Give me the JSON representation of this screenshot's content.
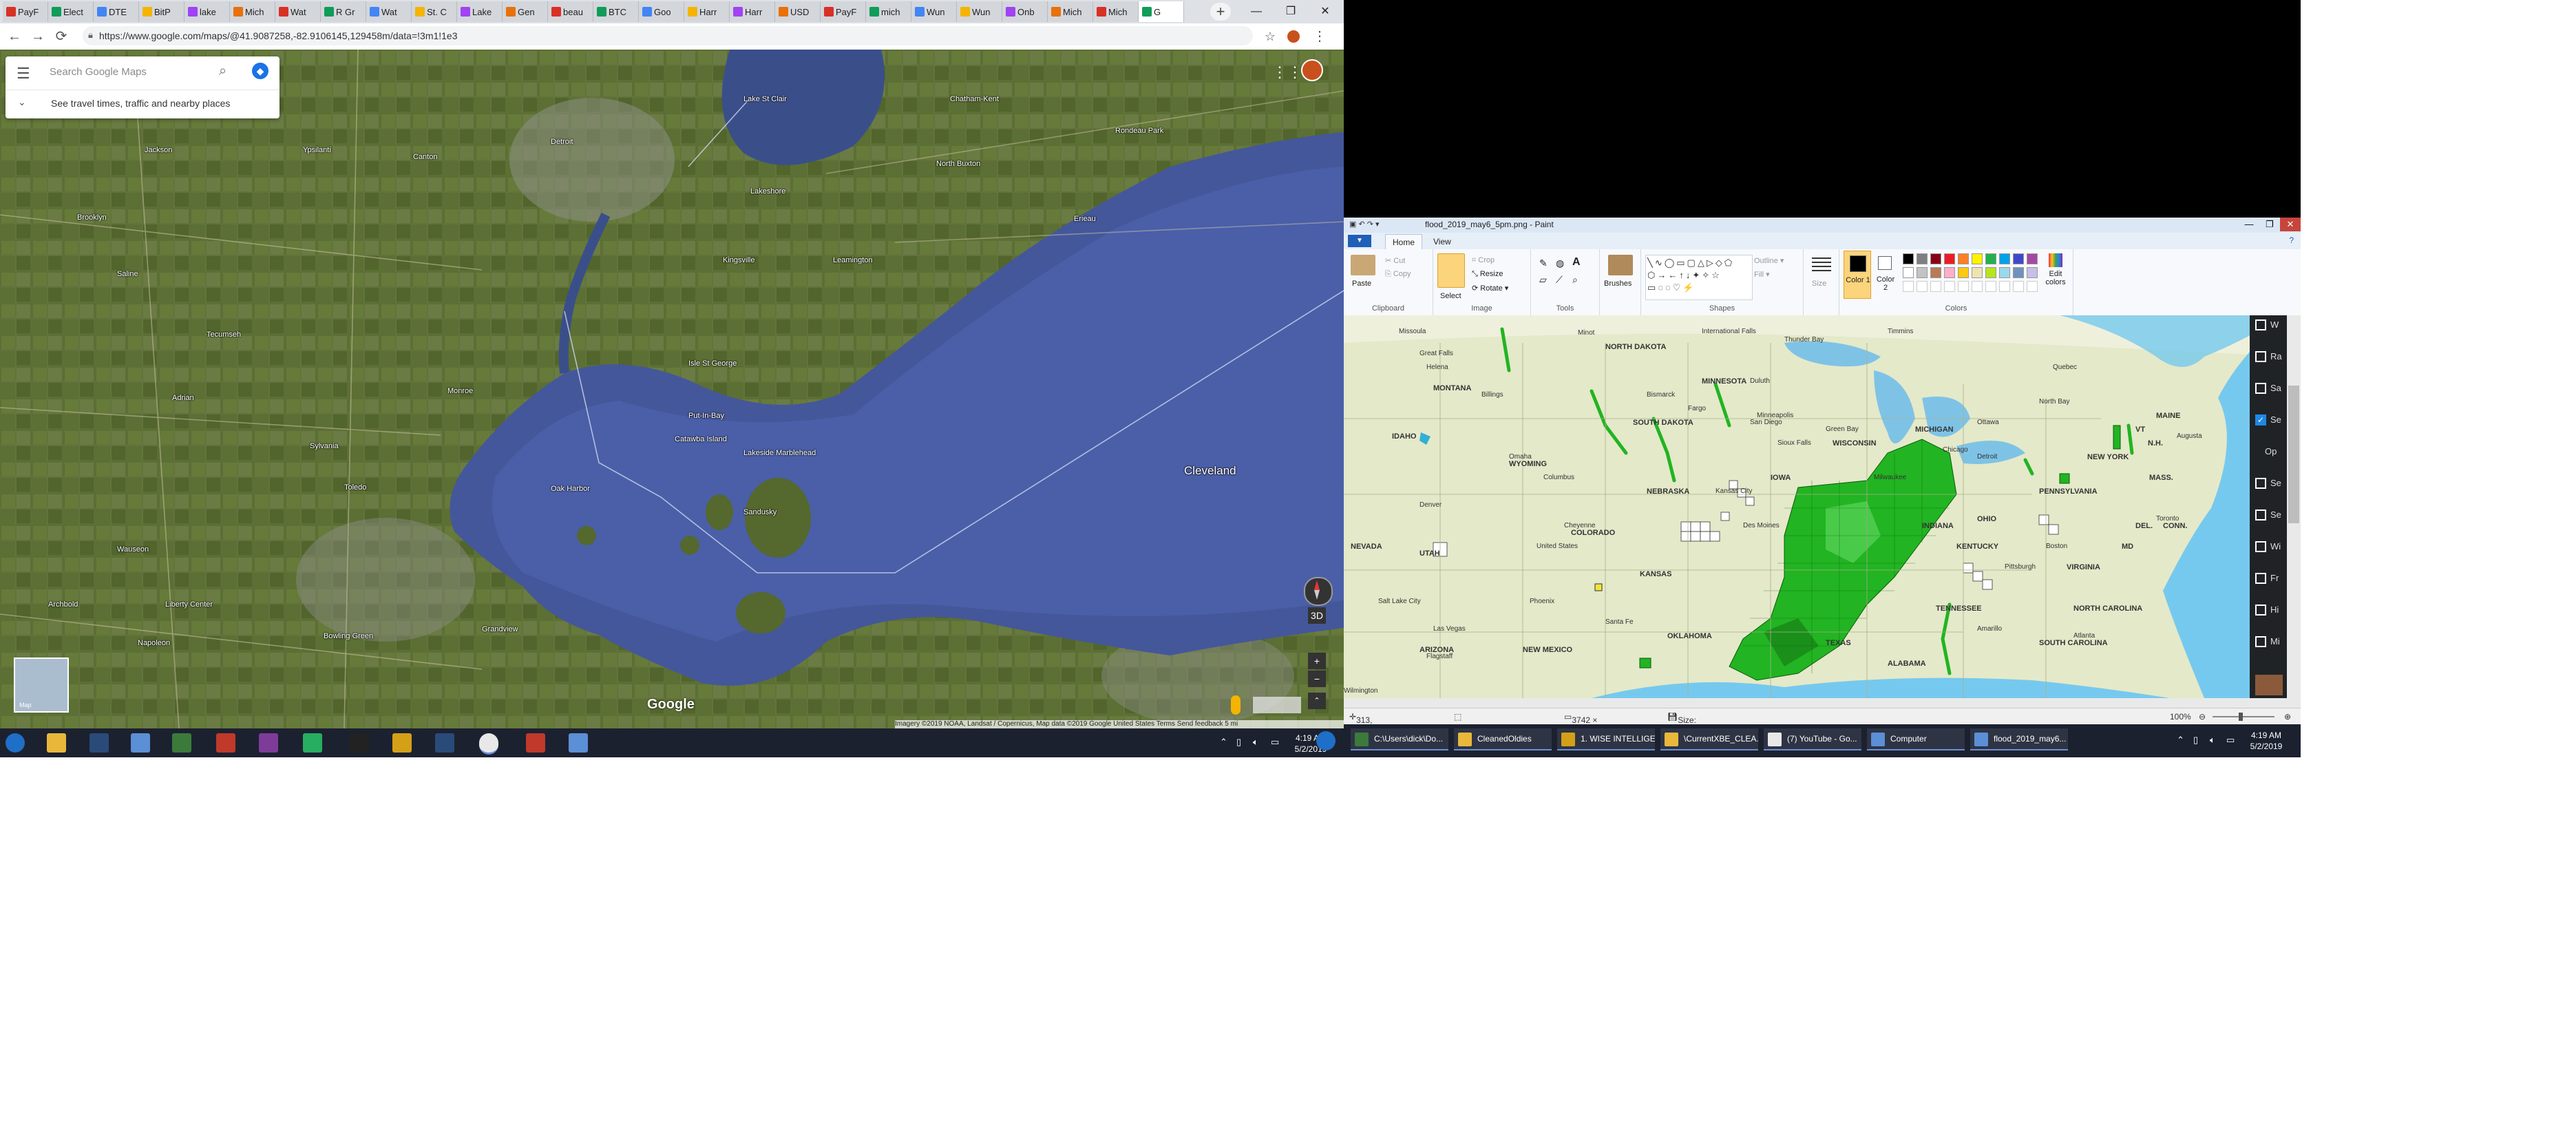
{
  "browser": {
    "tabs": [
      "PayF",
      "Elect",
      "DTE",
      "BitP",
      "lake",
      "Mich",
      "Wat",
      "R Gr",
      "Wat",
      "St. C",
      "Lake",
      "Gen",
      "beau",
      "BTC",
      "Goo",
      "Harr",
      "Harr",
      "USD",
      "PayF",
      "mich",
      "Wun",
      "Wun",
      "Onb",
      "Mich",
      "Mich",
      "G"
    ],
    "new_tab": "+",
    "window_controls": {
      "minimize": "—",
      "maximize": "❐",
      "close": "✕"
    },
    "nav": {
      "back": "←",
      "forward": "→",
      "reload": "⟳"
    },
    "url": "https://www.google.com/maps/@41.9087258,-82.9106145,129458m/data=!3m1!1e3"
  },
  "maps": {
    "search_placeholder": "Search Google Maps",
    "hint": "See travel times, traffic and nearby places",
    "minimap_label": "Map",
    "controls": {
      "tilt": "3D",
      "zoom_in": "+",
      "zoom_out": "−"
    },
    "logo": "Google",
    "attribution": "Imagery ©2019 NOAA, Landsat / Copernicus, Map data ©2019 Google    United States    Terms    Send feedback    5 mi",
    "places": [
      {
        "name": "Detroit",
        "big": false
      },
      {
        "name": "Lake St Clair",
        "big": false
      },
      {
        "name": "Chatham-Kent",
        "big": false
      },
      {
        "name": "Rondeau Park",
        "big": false
      },
      {
        "name": "Lakeshore",
        "big": false
      },
      {
        "name": "North Buxton",
        "big": false
      },
      {
        "name": "Kingsville",
        "big": false
      },
      {
        "name": "Leamington",
        "big": false
      },
      {
        "name": "Erieau",
        "big": false
      },
      {
        "name": "Isle St George",
        "big": false
      },
      {
        "name": "Put-In-Bay",
        "big": false
      },
      {
        "name": "Catawba Island",
        "big": false
      },
      {
        "name": "Lakeside Marblehead",
        "big": false
      },
      {
        "name": "Oak Harbor",
        "big": false
      },
      {
        "name": "Sandusky",
        "big": false
      },
      {
        "name": "Cleveland",
        "big": true
      },
      {
        "name": "Brooklyn",
        "big": false
      },
      {
        "name": "Saline",
        "big": false
      },
      {
        "name": "Tecumseh",
        "big": false
      },
      {
        "name": "Adrian",
        "big": false
      },
      {
        "name": "Monroe",
        "big": false
      },
      {
        "name": "Sylvania",
        "big": false
      },
      {
        "name": "Toledo",
        "big": false
      },
      {
        "name": "Wauseon",
        "big": false
      },
      {
        "name": "Archbold",
        "big": false
      },
      {
        "name": "Liberty Center",
        "big": false
      },
      {
        "name": "Napoleon",
        "big": false
      },
      {
        "name": "Bowling Green",
        "big": false
      },
      {
        "name": "Grandview",
        "big": false
      },
      {
        "name": "Ypsilanti",
        "big": false
      },
      {
        "name": "Canton",
        "big": false
      },
      {
        "name": "Jackson",
        "big": false
      }
    ]
  },
  "paint": {
    "title": "flood_2019_may6_5pm.png - Paint",
    "file_button": "▼",
    "tabs": [
      "Home",
      "View"
    ],
    "clipboard": {
      "paste": "Paste",
      "cut": "Cut",
      "copy": "Copy",
      "group": "Clipboard"
    },
    "image": {
      "select": "Select",
      "crop": "Crop",
      "resize": "Resize",
      "rotate": "Rotate ▾",
      "group": "Image"
    },
    "tools_group": "Tools",
    "brushes": "Brushes",
    "shapes": {
      "outline": "Outline ▾",
      "fill": "Fill ▾",
      "group": "Shapes"
    },
    "size": "Size",
    "color1": "Color 1",
    "color2": "Color 2",
    "edit_colors": "Edit colors",
    "colors_group": "Colors",
    "palette": [
      "#000000",
      "#7f7f7f",
      "#880015",
      "#ed1c24",
      "#ff7f27",
      "#fff200",
      "#22b14c",
      "#00a2e8",
      "#3f48cc",
      "#a349a4",
      "#ffffff",
      "#c3c3c3",
      "#b97a57",
      "#ffaec9",
      "#ffc90e",
      "#efe4b0",
      "#b5e61d",
      "#99d9ea",
      "#7092be",
      "#c8bfe7"
    ],
    "status": {
      "cursor": "313, 487px",
      "dimensions": "3742 × 1634px",
      "size": "Size: 1.3MB",
      "zoom": "100%"
    },
    "map_labels": [
      "NORTH DAKOTA",
      "MINNESOTA",
      "MONTANA",
      "SOUTH DAKOTA",
      "WYOMING",
      "IDAHO",
      "NEBRASKA",
      "IOWA",
      "WISCONSIN",
      "MICHIGAN",
      "COLORADO",
      "KANSAS",
      "UTAH",
      "NEVADA",
      "ARIZONA",
      "NEW MEXICO",
      "OKLAHOMA",
      "TEXAS",
      "INDIANA",
      "OHIO",
      "KENTUCKY",
      "TENNESSEE",
      "ALABAMA",
      "PENNSYLVANIA",
      "VIRGINIA",
      "NORTH CAROLINA",
      "SOUTH CAROLINA",
      "NEW YORK",
      "MAINE",
      "MASS.",
      "VT",
      "N.H.",
      "CONN.",
      "DEL.",
      "MD"
    ],
    "map_cities": [
      "Great Falls",
      "Helena",
      "Billings",
      "Missoula",
      "Minot",
      "Bismarck",
      "Fargo",
      "International Falls",
      "Thunder Bay",
      "Timmins",
      "Quebec",
      "North Bay",
      "Ottawa",
      "Augusta",
      "Duluth",
      "Minneapolis",
      "Green Bay",
      "Milwaukee",
      "Chicago",
      "Detroit",
      "Toronto",
      "Boston",
      "Pittsburgh",
      "Columbus",
      "Cheyenne",
      "Denver",
      "Salt Lake City",
      "Las Vegas",
      "Flagstaff",
      "Phoenix",
      "Santa Fe",
      "Amarillo",
      "Atlanta",
      "Wilmington",
      "San Diego",
      "Sioux Falls",
      "Des Moines",
      "Kansas City",
      "Omaha",
      "United States"
    ],
    "side_panel": [
      {
        "label": "W",
        "checked": false
      },
      {
        "label": "Ra",
        "checked": false
      },
      {
        "label": "Sa",
        "checked": false
      },
      {
        "label": "Se",
        "checked": true
      },
      {
        "label": "Op",
        "checked": false
      },
      {
        "label": "Se",
        "checked": false
      },
      {
        "label": "Se",
        "checked": false
      },
      {
        "label": "Wi",
        "checked": false
      },
      {
        "label": "Fr",
        "checked": false
      },
      {
        "label": "Hi",
        "checked": false
      },
      {
        "label": "Mi",
        "checked": false
      }
    ]
  },
  "taskbar_left": {
    "clock_time": "4:19 AM",
    "clock_date": "5/2/2019"
  },
  "taskbar_right": {
    "windows": [
      "C:\\Users\\dick\\Do...",
      "CleanedOldies",
      "1. WISE INTELLIGE...",
      "\\CurrentXBE_CLEA...",
      "(7) YouTube - Go...",
      "Computer",
      "flood_2019_may6..."
    ],
    "clock_time": "4:19 AM",
    "clock_date": "5/2/2019"
  }
}
